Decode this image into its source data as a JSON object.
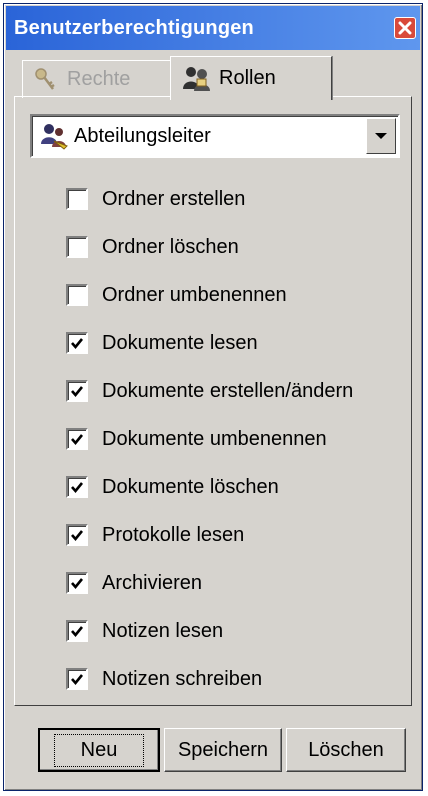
{
  "window": {
    "title": "Benutzerberechtigungen"
  },
  "tabs": [
    {
      "label": "Rechte",
      "icon": "keys-icon",
      "active": false
    },
    {
      "label": "Rollen",
      "icon": "users-icon",
      "active": true
    }
  ],
  "role_select": {
    "value": "Abteilungsleiter",
    "icon": "role-users-icon"
  },
  "permissions": [
    {
      "label": "Ordner erstellen",
      "checked": false
    },
    {
      "label": "Ordner löschen",
      "checked": false
    },
    {
      "label": "Ordner umbenennen",
      "checked": false
    },
    {
      "label": "Dokumente lesen",
      "checked": true
    },
    {
      "label": "Dokumente erstellen/ändern",
      "checked": true
    },
    {
      "label": "Dokumente umbenennen",
      "checked": true
    },
    {
      "label": "Dokumente löschen",
      "checked": true
    },
    {
      "label": "Protokolle lesen",
      "checked": true
    },
    {
      "label": "Archivieren",
      "checked": true
    },
    {
      "label": "Notizen lesen",
      "checked": true
    },
    {
      "label": "Notizen schreiben",
      "checked": true
    }
  ],
  "buttons": {
    "new": "Neu",
    "save": "Speichern",
    "delete": "Löschen"
  },
  "colors": {
    "titlebar": "#2a64d8",
    "face": "#d6d3ce",
    "close": "#d94a3a"
  }
}
